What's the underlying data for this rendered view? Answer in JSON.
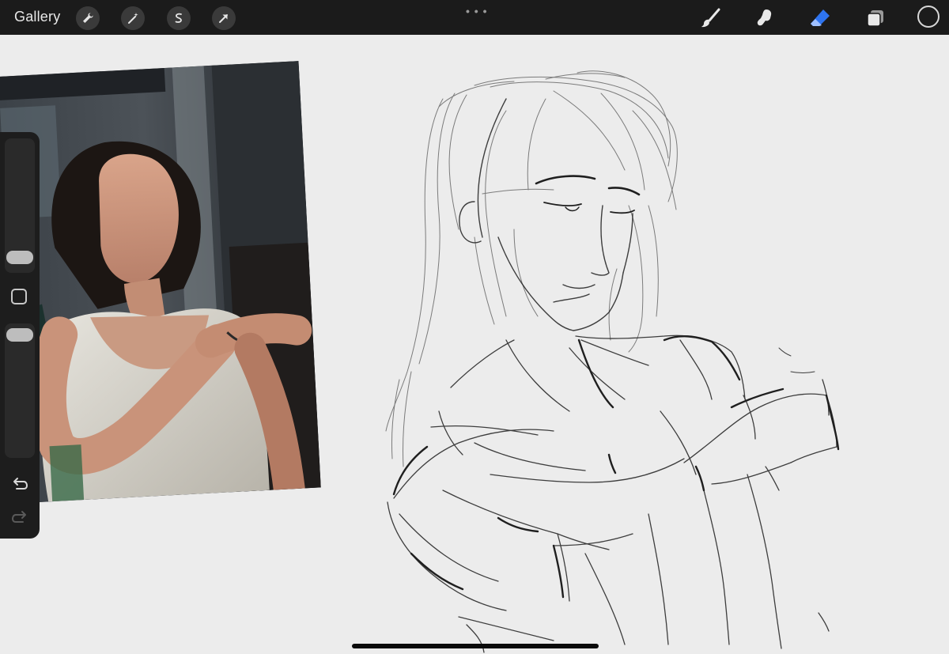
{
  "toolbar": {
    "gallery_label": "Gallery",
    "left_tools": [
      "wrench-icon",
      "magic-wand-icon",
      "selection-icon",
      "transform-arrow-icon"
    ],
    "right_tools": [
      "brush-icon",
      "smudge-icon",
      "eraser-icon",
      "layers-icon",
      "color-swatch"
    ],
    "active_tool": "eraser",
    "accent_color": "#2e74f0",
    "current_color": "#1c1c1c"
  },
  "sidebar": {
    "brush_size_level": 0.3,
    "opacity_level": 0.97,
    "icons": [
      "undo-icon",
      "redo-icon"
    ]
  },
  "reference": {
    "kind": "photo",
    "subject": "person-in-white-tank-top"
  },
  "colors": {
    "canvas": "#ececec",
    "toolbar": "#1b1b1b",
    "sidebar": "#1d1d1d",
    "sketch_stroke": "#1f1f1f"
  }
}
